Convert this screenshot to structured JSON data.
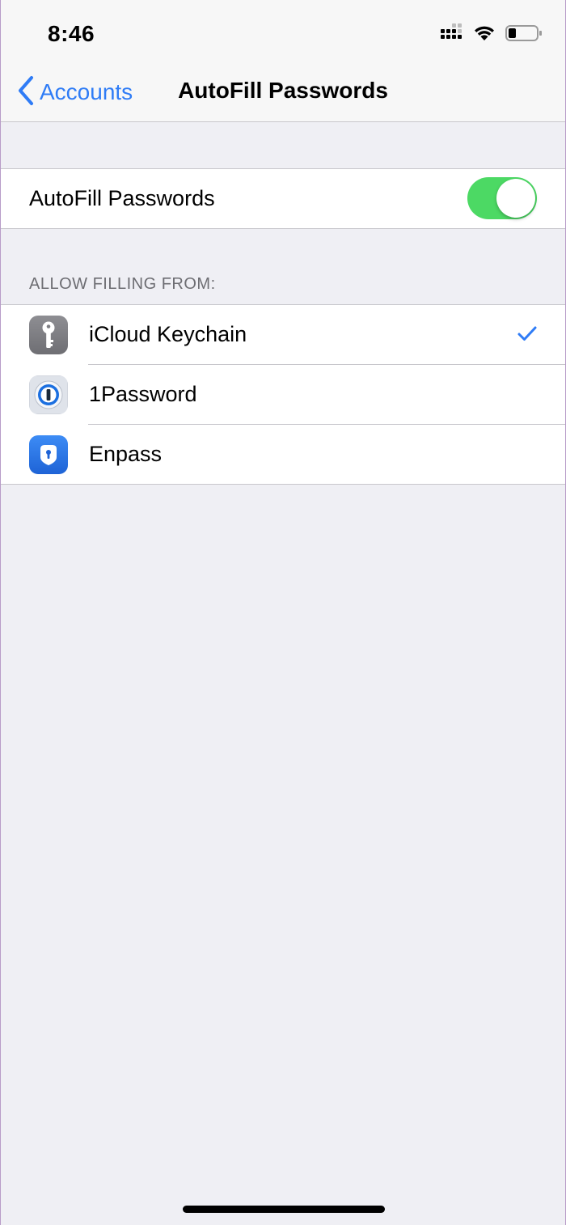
{
  "status_bar": {
    "time": "8:46",
    "icons": [
      "cellular-signal-icon",
      "wifi-icon",
      "battery-icon"
    ]
  },
  "nav": {
    "back_label": "Accounts",
    "title": "AutoFill Passwords"
  },
  "autofill": {
    "label": "AutoFill Passwords",
    "enabled": true
  },
  "section": {
    "header": "ALLOW FILLING FROM:"
  },
  "providers": [
    {
      "label": "iCloud Keychain",
      "icon": "key-icon",
      "selected": true
    },
    {
      "label": "1Password",
      "icon": "1password-icon",
      "selected": false
    },
    {
      "label": "Enpass",
      "icon": "enpass-icon",
      "selected": false
    }
  ],
  "colors": {
    "accent": "#2f7cf6",
    "switch_on": "#4cd964",
    "background": "#efeff4",
    "separator": "#c8c7cc",
    "header_text": "#6d6d72"
  }
}
